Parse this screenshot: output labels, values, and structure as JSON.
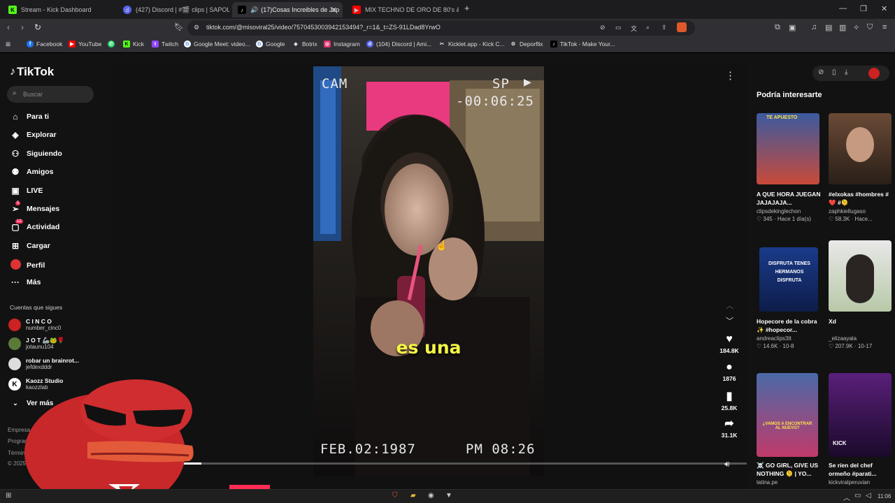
{
  "tabs": [
    {
      "icon": "kick-icon",
      "label": "Stream - Kick Dashboard",
      "active": false
    },
    {
      "icon": "discord-icon",
      "label": "(427) Discord | #🎬 clips | SAPOLIC",
      "active": false
    },
    {
      "icon": "tiktok-icon",
      "label": "(17)Cosas Increibles de Japón",
      "active": true
    },
    {
      "icon": "youtube-icon",
      "label": "MIX TECHNO DE ORO DE 80's & 90's",
      "active": false
    }
  ],
  "address": {
    "url": "tiktok.com/@misoviral25/video/7570453003942153494?_r=1&_t=ZS-91LDad8YrwO"
  },
  "bookmarks": [
    {
      "icon": "facebook-icon",
      "label": "Facebook",
      "color": "#1877f2"
    },
    {
      "icon": "youtube-icon",
      "label": "YouTube",
      "color": "#ff0000"
    },
    {
      "icon": "whatsapp-icon",
      "label": "",
      "color": "#25d366"
    },
    {
      "icon": "kick-icon",
      "label": "Kick",
      "color": "#53fc18"
    },
    {
      "icon": "twitch-icon",
      "label": "Twitch",
      "color": "#9146ff"
    },
    {
      "icon": "google-icon",
      "label": "Google Meet: video...",
      "color": "#4285f4"
    },
    {
      "icon": "google-icon",
      "label": "Google",
      "color": "#4285f4"
    },
    {
      "icon": "botrix-icon",
      "label": "Botrix",
      "color": "#888888"
    },
    {
      "icon": "instagram-icon",
      "label": "Instagram",
      "color": "#e1306c"
    },
    {
      "icon": "discord-icon",
      "label": "(104) Discord | Ami...",
      "color": "#5865f2"
    },
    {
      "icon": "kicklet-icon",
      "label": "Kicklet.app - Kick C...",
      "color": "#777777"
    },
    {
      "icon": "deporflix-icon",
      "label": "Deporflix",
      "color": "#888888"
    },
    {
      "icon": "tiktok-icon",
      "label": "TikTok - Make Your...",
      "color": "#000000"
    }
  ],
  "sidebar": {
    "logo": "TikTok",
    "search_placeholder": "Buscar",
    "items": [
      {
        "icon": "home-icon",
        "label": "Para ti"
      },
      {
        "icon": "compass-icon",
        "label": "Explorar"
      },
      {
        "icon": "following-icon",
        "label": "Siguiendo"
      },
      {
        "icon": "friends-icon",
        "label": "Amigos"
      },
      {
        "icon": "live-icon",
        "label": "LIVE"
      },
      {
        "icon": "messages-icon",
        "label": "Mensajes",
        "badge": "5"
      },
      {
        "icon": "activity-icon",
        "label": "Actividad",
        "badge": "12"
      },
      {
        "icon": "upload-icon",
        "label": "Cargar"
      },
      {
        "icon": "profile-icon",
        "label": "Perfil"
      },
      {
        "icon": "more-icon",
        "label": "Más"
      }
    ],
    "following_title": "Cuentas que sigues",
    "following": [
      {
        "name": "C I N C O",
        "handle": "number_cinc0"
      },
      {
        "name": "J O T 🦾🐸🌹",
        "handle": "jotaunu104"
      },
      {
        "name": "robar un brainrot...",
        "handle": "jefdexdddr"
      },
      {
        "name": "Kaozz Studio",
        "handle": "kaozzlab"
      }
    ],
    "see_more": "Ver más",
    "footer": [
      "Empresa",
      "Progran",
      "Términ",
      "© 2025"
    ]
  },
  "video": {
    "overlay_cam": "CAM",
    "overlay_sp": "SP",
    "overlay_time": "-00:06:25",
    "overlay_date": "FEB.02:1987",
    "overlay_clock": "PM 08:26",
    "caption": "es una"
  },
  "actions": {
    "likes": "184.8K",
    "comments": "1876",
    "saves": "25.8K",
    "shares": "31.1K"
  },
  "recommendations": {
    "title": "Podría interesarte",
    "cards": [
      {
        "title": "A QUE HORA JUEGAN JAJAJAJA...",
        "user": "clipsdekinglechon",
        "meta": "♡ 345 · Hace 1 día(s)"
      },
      {
        "title": "#elxokas #hombres #❤️ #🫠",
        "user": "zaphkiellugaso",
        "meta": "♡ 58.3K · Hace..."
      },
      {
        "title": "Hopecore de la cobra ✨ #hopecor...",
        "user": "andreaclips3tt",
        "meta": "♡ 14.6K · 10-8"
      },
      {
        "title": "Xd",
        "user": "_elizaayala",
        "meta": "♡ 207.9K · 10-17"
      },
      {
        "title": "☠️ GO GIRL, GIVE US NOTHING 🫠 | YO...",
        "user": "latina.pe",
        "meta": ""
      },
      {
        "title": "Se ríen del chef ormeño #parati...",
        "user": "kickviralperuvian",
        "meta": ""
      }
    ],
    "thumb_texts": [
      "TE APUESTO",
      "",
      "DISFRUTA TENES HERMANOS DISFRUTA",
      "",
      "¿VAMOS A ENCONTRAR AL NUEVO?",
      "KICK"
    ]
  },
  "taskbar": {
    "time": "11:06"
  }
}
